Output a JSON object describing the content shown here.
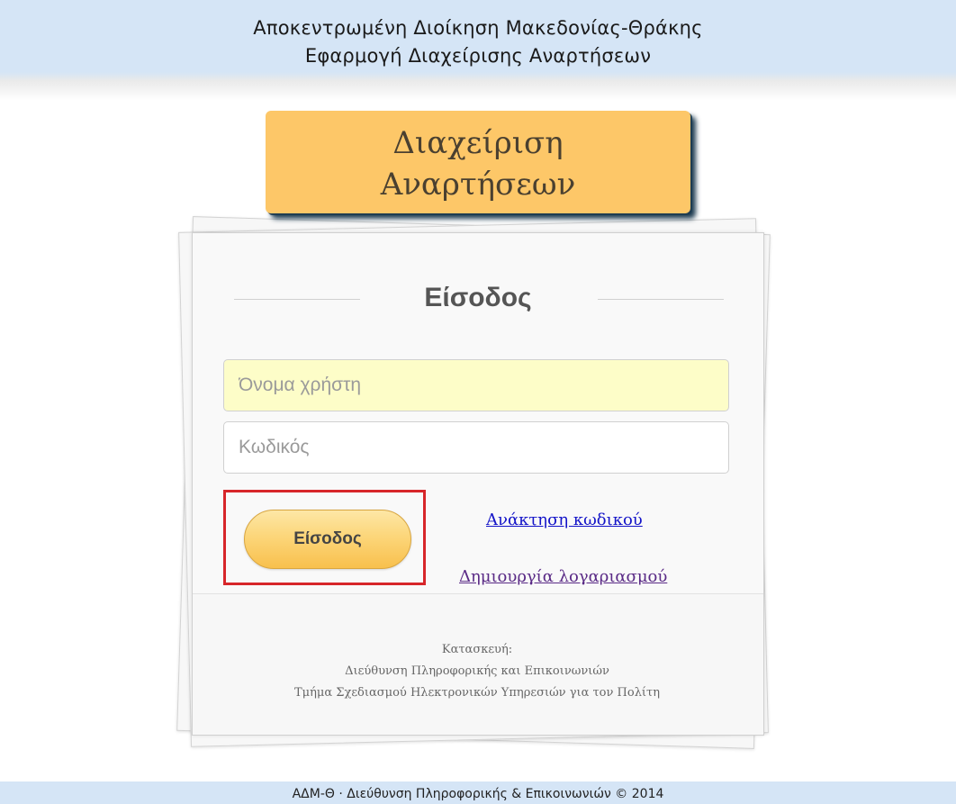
{
  "header": {
    "line1": "Αποκεντρωμένη Διοίκηση Μακεδονίας-Θράκης",
    "line2": "Εφαρμογή Διαχείρισης Αναρτήσεων"
  },
  "badge": {
    "line1": "Διαχείριση",
    "line2": "Αναρτήσεων"
  },
  "login": {
    "heading": "Είσοδος",
    "username_placeholder": "Όνομα χρήστη",
    "username_value": "",
    "password_placeholder": "Κωδικός",
    "password_value": "",
    "submit_label": "Είσοδος",
    "recover_link": "Ανάκτηση κωδικού",
    "create_account_link": "Δημιουργία λογαριασμού"
  },
  "credits": {
    "line1": "Κατασκευή:",
    "line2": "Διεύθυνση Πληροφορικής και Επικοινωνιών",
    "line3": "Τμήμα Σχεδιασμού Ηλεκτρονικών Υπηρεσιών για τον Πολίτη"
  },
  "footer": {
    "text": "ΑΔΜ-Θ · Διεύθυνση Πληροφορικής & Επικοινωνιών © 2014"
  },
  "colors": {
    "header_band": "#d5e5f6",
    "badge": "#fdc768",
    "badge_shadow": "#1f3d52",
    "highlight_border": "#d7262a",
    "username_bg": "#fdfdc8",
    "link": "#1414c8",
    "visited_link": "#5a2a86"
  }
}
